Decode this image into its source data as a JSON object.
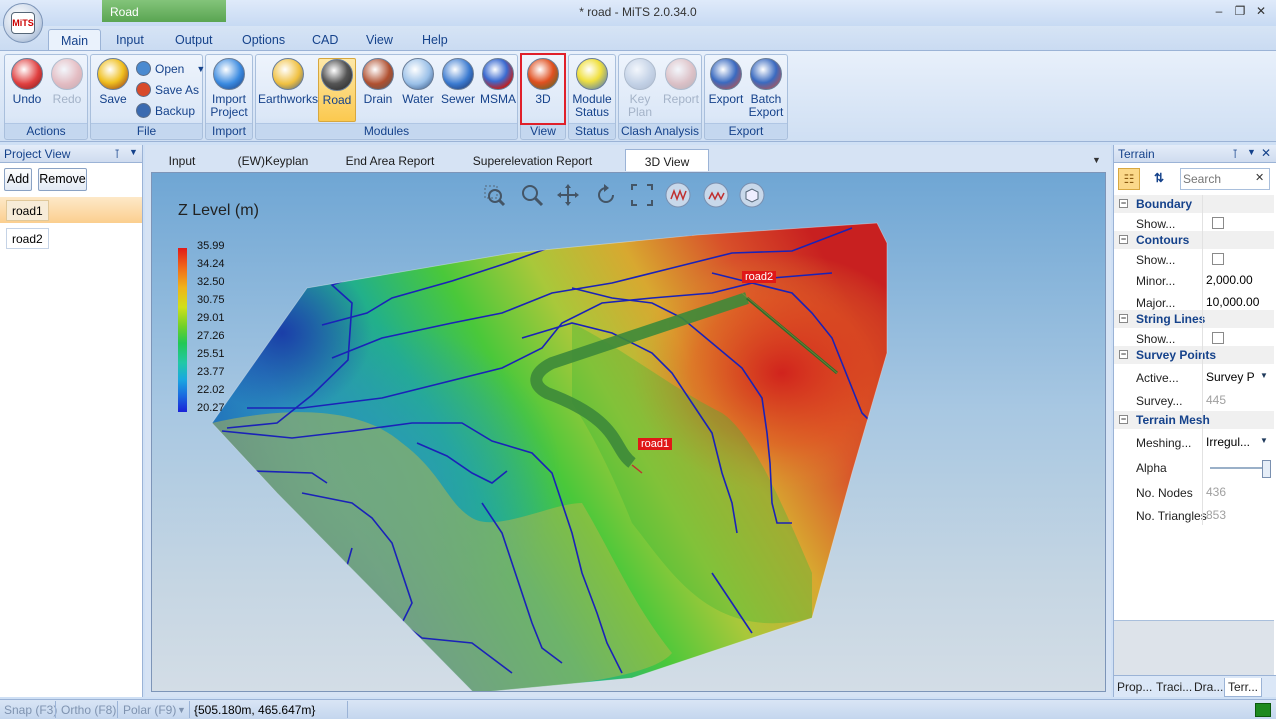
{
  "window": {
    "title": "* road - MiTS 2.0.34.0",
    "context_tab": "Road",
    "app_logo": "MiTS"
  },
  "menu_tabs": [
    "Main",
    "Input",
    "Output",
    "Options",
    "CAD",
    "View",
    "Help"
  ],
  "ribbon": {
    "actions": {
      "label": "Actions",
      "undo": "Undo",
      "redo": "Redo"
    },
    "file": {
      "label": "File",
      "save": "Save",
      "open": "Open",
      "save_as": "Save As",
      "backup": "Backup"
    },
    "import": {
      "label": "Import",
      "import_project_1": "Import",
      "import_project_2": "Project"
    },
    "modules": {
      "label": "Modules",
      "earthworks": "Earthworks",
      "road": "Road",
      "drain": "Drain",
      "water": "Water",
      "sewer": "Sewer",
      "msma": "MSMA"
    },
    "view": {
      "label": "View",
      "three_d": "3D"
    },
    "status": {
      "label": "Status",
      "module_status_1": "Module",
      "module_status_2": "Status"
    },
    "clash": {
      "label": "Clash Analysis",
      "key_plan_1": "Key",
      "key_plan_2": "Plan",
      "report": "Report"
    },
    "export": {
      "label": "Export",
      "export": "Export",
      "batch_export_1": "Batch",
      "batch_export_2": "Export"
    }
  },
  "project_view": {
    "title": "Project View",
    "add": "Add",
    "remove": "Remove",
    "items": [
      "road1",
      "road2"
    ]
  },
  "doc_tabs": [
    "Input",
    "(EW)Keyplan",
    "End Area Report",
    "Superelevation Report",
    "3D View"
  ],
  "viewport": {
    "legend_title": "Z Level (m)",
    "legend_values": [
      "35.99",
      "34.24",
      "32.50",
      "30.75",
      "29.01",
      "27.26",
      "25.51",
      "23.77",
      "22.02",
      "20.27"
    ],
    "road_labels": [
      "road1",
      "road2"
    ]
  },
  "terrain": {
    "title": "Terrain",
    "search_placeholder": "Search",
    "categories": {
      "boundary": "Boundary",
      "contours": "Contours",
      "string_lines": "String Lines",
      "survey_points": "Survey Points",
      "terrain_mesh": "Terrain Mesh"
    },
    "props": {
      "boundary_show": "Show...",
      "contours_show": "Show...",
      "minor": "Minor...",
      "minor_val": "2,000.00",
      "major": "Major...",
      "major_val": "10,000.00",
      "string_show": "Show...",
      "active": "Active...",
      "active_val": "Survey P",
      "survey": "Survey...",
      "survey_val": "445",
      "meshing": "Meshing...",
      "meshing_val": "Irregul...",
      "alpha": "Alpha",
      "nodes": "No. Nodes",
      "nodes_val": "436",
      "triangles": "No. Triangles",
      "triangles_val": "853"
    },
    "bottom_tabs": [
      "Prop...",
      "Traci...",
      "Dra...",
      "Terr..."
    ]
  },
  "status": {
    "snap": "Snap (F3)",
    "ortho": "Ortho (F8)",
    "polar": "Polar (F9)",
    "coords": "{505.180m, 465.647m}"
  }
}
